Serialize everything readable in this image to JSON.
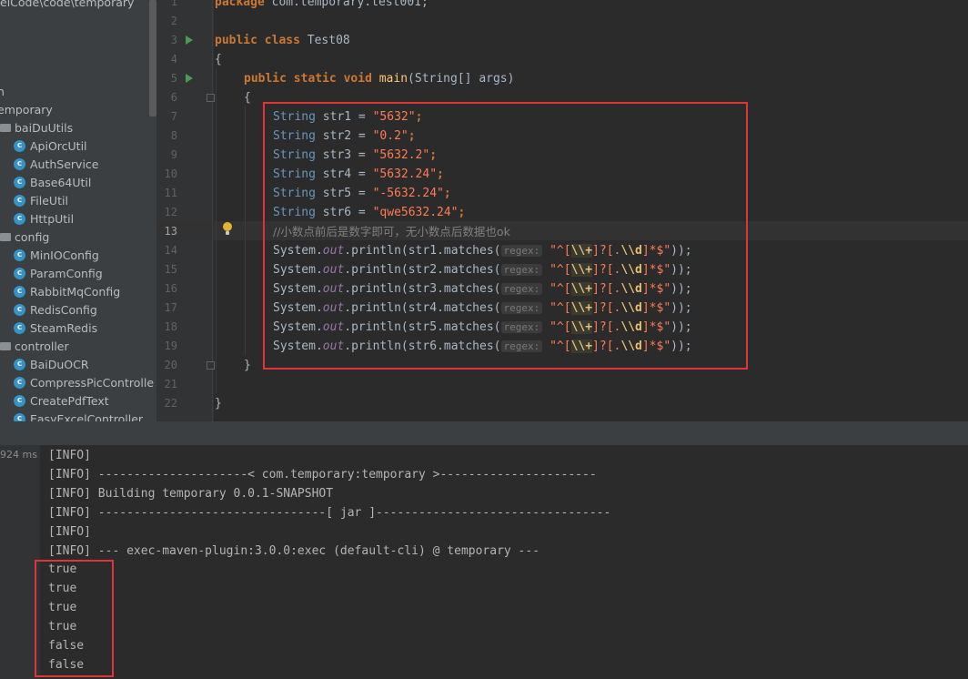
{
  "project_tree": {
    "path_label": "eiCode\\code\\temporary",
    "items": [
      {
        "type": "fragment",
        "label": "n"
      },
      {
        "type": "root",
        "label": "emporary"
      },
      {
        "type": "folder",
        "label": "baiDuUtils"
      },
      {
        "type": "class",
        "label": "ApiOrcUtil"
      },
      {
        "type": "class",
        "label": "AuthService"
      },
      {
        "type": "class",
        "label": "Base64Util"
      },
      {
        "type": "class",
        "label": "FileUtil"
      },
      {
        "type": "class",
        "label": "HttpUtil"
      },
      {
        "type": "folder",
        "label": "config"
      },
      {
        "type": "class",
        "label": "MinIOConfig"
      },
      {
        "type": "class",
        "label": "ParamConfig"
      },
      {
        "type": "class",
        "label": "RabbitMqConfig"
      },
      {
        "type": "class",
        "label": "RedisConfig"
      },
      {
        "type": "class",
        "label": "SteamRedis"
      },
      {
        "type": "folder",
        "label": "controller"
      },
      {
        "type": "class",
        "label": "BaiDuOCR"
      },
      {
        "type": "class",
        "label": "CompressPicControlle"
      },
      {
        "type": "class",
        "label": "CreatePdfText"
      },
      {
        "type": "class",
        "label": "EasyExcelController"
      }
    ]
  },
  "editor": {
    "line_numbers": [
      "1",
      "2",
      "3",
      "4",
      "5",
      "6",
      "7",
      "8",
      "9",
      "10",
      "11",
      "12",
      "13",
      "14",
      "15",
      "16",
      "17",
      "18",
      "19",
      "20",
      "21",
      "22"
    ],
    "current_line": "13",
    "code": {
      "package_kw": "package",
      "package_name": "com.temporary.test001;",
      "public_kw": "public",
      "class_kw": "class",
      "class_name": "Test08",
      "open_brace": "{",
      "close_brace": "}",
      "static_kw": "static",
      "void_kw": "void",
      "main_name": "main",
      "main_params": "(String[] args)",
      "string_type": "String",
      "declarations": [
        {
          "name": "str1",
          "value": "\"5632\""
        },
        {
          "name": "str2",
          "value": "\"0.2\""
        },
        {
          "name": "str3",
          "value": "\"5632.2\""
        },
        {
          "name": "str4",
          "value": "\"5632.24\""
        },
        {
          "name": "str5",
          "value": "\"-5632.24\""
        },
        {
          "name": "str6",
          "value": "\"qwe5632.24\""
        }
      ],
      "assign": " = ",
      "semicolon": ";",
      "comment": "//小数点前后是数字即可，无小数点后数据也ok",
      "print_prefix": "System.",
      "print_out": "out",
      "print_fn": ".println(",
      "matches_fn": ".matches(",
      "regex_hint": "regex:",
      "regex_parts": [
        "\"^[",
        "\\\\+",
        "]?[.",
        "\\\\d",
        "]*$\"",
        "));"
      ],
      "print_args": [
        "str1",
        "str2",
        "str3",
        "str4",
        "str5",
        "str6"
      ]
    }
  },
  "console": {
    "elapsed": "924 ms",
    "lines": [
      "[INFO]",
      "[INFO] ---------------------< com.temporary:temporary >----------------------",
      "[INFO] Building temporary 0.0.1-SNAPSHOT",
      "[INFO] --------------------------------[ jar ]---------------------------------",
      "[INFO]",
      "[INFO] --- exec-maven-plugin:3.0.0:exec (default-cli) @ temporary ---",
      "true",
      "true",
      "true",
      "true",
      "false",
      "false"
    ]
  },
  "colors": {
    "highlight_box": "#e03535",
    "keyword": "#cc7832",
    "string": "#6a8759",
    "run_icon": "#499c54"
  }
}
